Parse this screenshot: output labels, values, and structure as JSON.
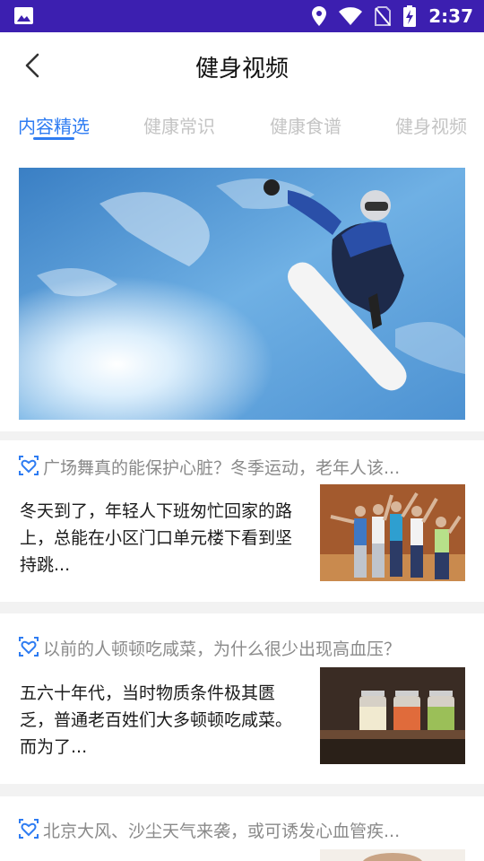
{
  "status_bar": {
    "time": "2:37",
    "icons": [
      "image-icon",
      "location-icon",
      "wifi-icon",
      "no-sim-icon",
      "battery-charging-icon"
    ]
  },
  "header": {
    "title": "健身视频",
    "back_icon": "chevron-left-icon"
  },
  "tabs": [
    {
      "label": "内容精选",
      "active": true
    },
    {
      "label": "健康常识",
      "active": false
    },
    {
      "label": "健康食谱",
      "active": false
    },
    {
      "label": "健身视频",
      "active": false
    }
  ],
  "colors": {
    "status_bar": "#3c1fb0",
    "accent": "#2e7cf2",
    "inactive_tab": "#c4c4c4",
    "headline": "#8a8a8a"
  },
  "banner": {
    "image": "snowboarder-sky-photo"
  },
  "articles": [
    {
      "icon": "heart-shield-icon",
      "headline": "广场舞真的能保护心脏？冬季运动，老年人该...",
      "excerpt": "冬天到了，年轻人下班匆忙回家的路上，总能在小区门口单元楼下看到坚持跳...",
      "thumbnail": "seniors-exercising-photo"
    },
    {
      "icon": "heart-shield-icon",
      "headline": "以前的人顿顿吃咸菜，为什么很少出现高血压？",
      "excerpt": "五六十年代，当时物质条件极其匮乏，普通老百姓们大多顿顿吃咸菜。而为了...",
      "thumbnail": "pickle-jars-photo"
    },
    {
      "icon": "heart-shield-icon",
      "headline": "北京大风、沙尘天气来袭，或可诱发心血管疾...",
      "excerpt": "",
      "thumbnail": "person-photo"
    }
  ]
}
